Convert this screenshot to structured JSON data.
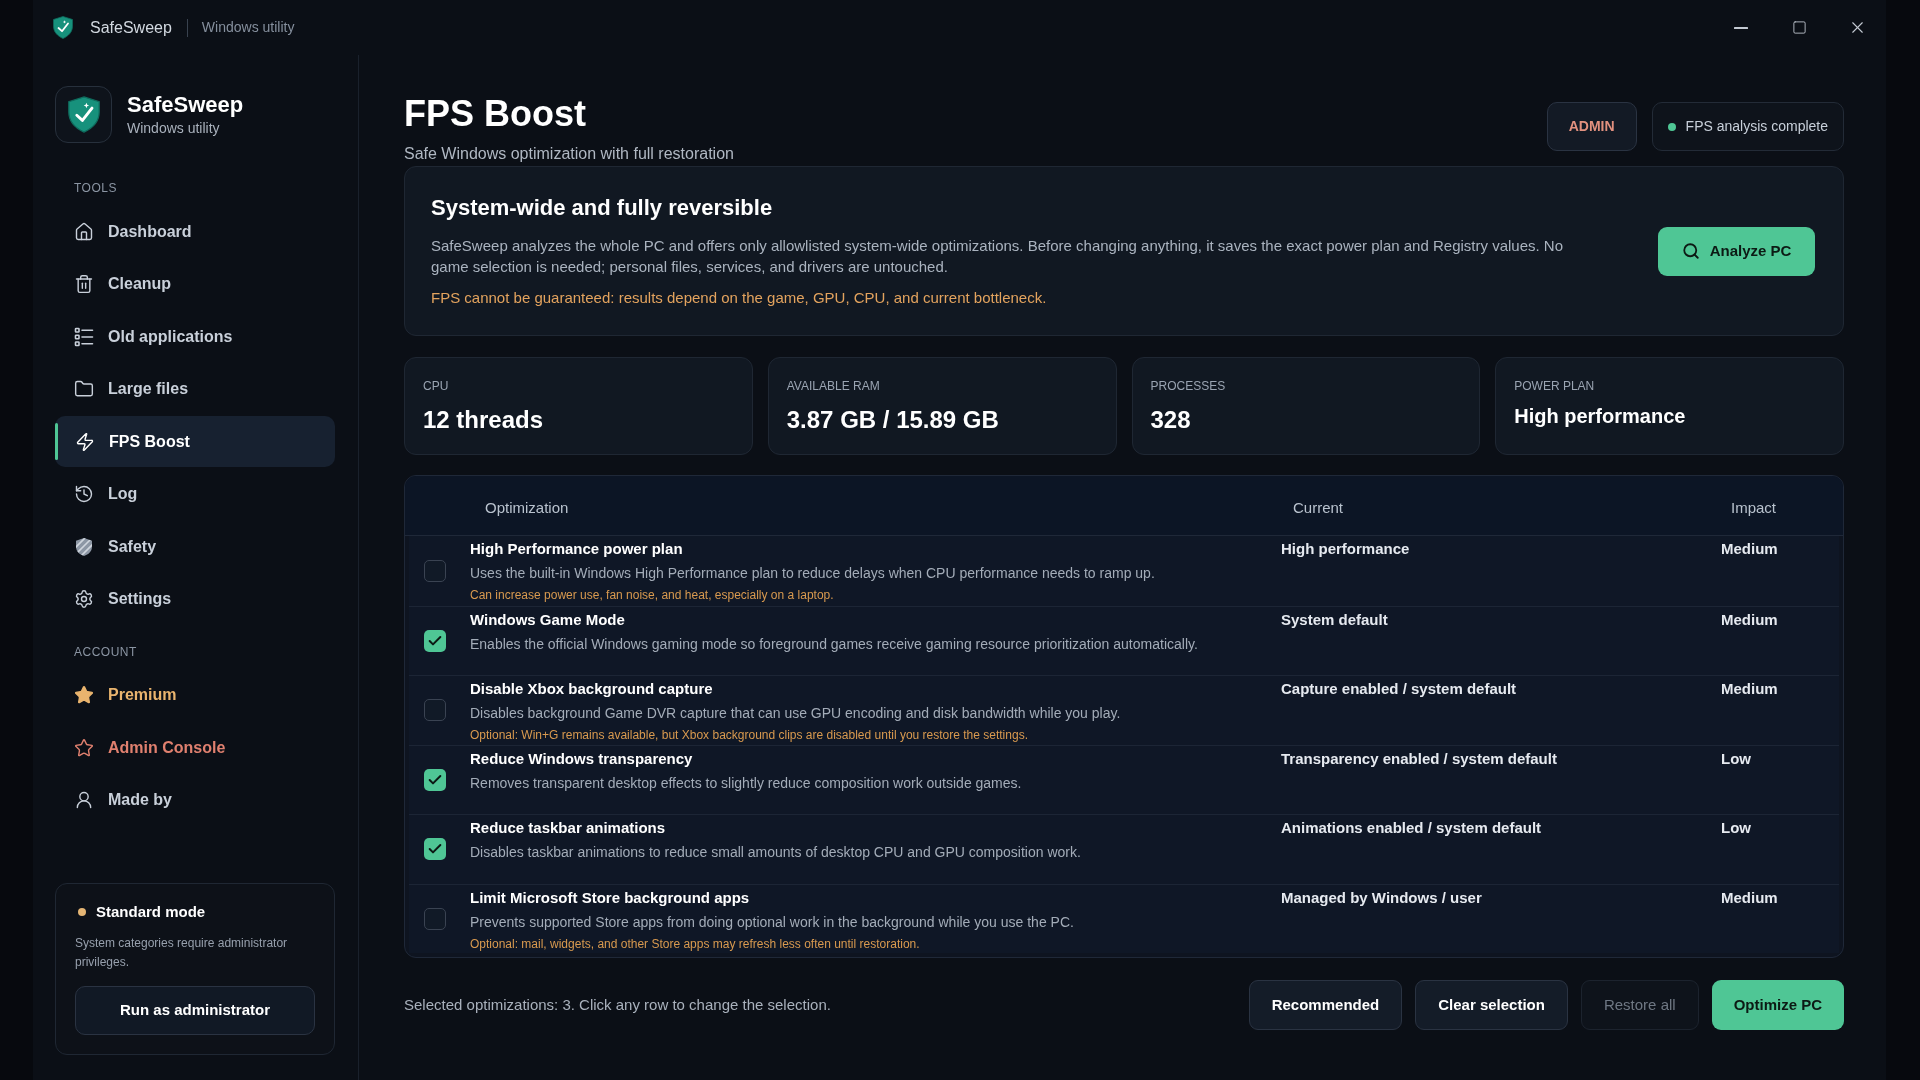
{
  "window": {
    "title": "SafeSweep",
    "subtitle": "Windows utility"
  },
  "sidebar": {
    "brand": {
      "name": "SafeSweep",
      "tagline": "Windows utility"
    },
    "sections": [
      {
        "label": "TOOLS",
        "items": [
          {
            "label": "Dashboard",
            "selected": false
          },
          {
            "label": "Cleanup",
            "selected": false
          },
          {
            "label": "Old applications",
            "selected": false
          },
          {
            "label": "Large files",
            "selected": false
          },
          {
            "label": "FPS Boost",
            "selected": true
          },
          {
            "label": "Log",
            "selected": false
          },
          {
            "label": "Safety",
            "selected": false
          },
          {
            "label": "Settings",
            "selected": false
          }
        ]
      },
      {
        "label": "ACCOUNT",
        "items": [
          {
            "label": "Premium",
            "selected": false,
            "color": "#e9b46e"
          },
          {
            "label": "Admin Console",
            "selected": false,
            "color": "#e0806f"
          },
          {
            "label": "Made by",
            "selected": false
          }
        ]
      }
    ],
    "mode_card": {
      "title": "Standard mode",
      "description": "System categories require administrator privileges.",
      "button": "Run as administrator"
    }
  },
  "header": {
    "title": "FPS Boost",
    "subtitle": "Safe Windows optimization with full restoration",
    "badges": [
      {
        "label": "ADMIN",
        "kind": "role"
      },
      {
        "label": "FPS analysis complete",
        "kind": "status"
      }
    ]
  },
  "info_card": {
    "title": "System-wide and fully reversible",
    "description": "SafeSweep analyzes the whole PC and offers only allowlisted system-wide optimizations. Before changing anything, it saves the exact power plan and Registry values. No game selection is needed; personal files, services, and drivers are untouched.",
    "warning": "FPS cannot be guaranteed: results depend on the game, GPU, CPU, and current bottleneck.",
    "button": "Analyze PC"
  },
  "stats": [
    {
      "label": "CPU",
      "value": "12 threads",
      "kind": "metric"
    },
    {
      "label": "AVAILABLE RAM",
      "value": "3.87 GB / 15.89 GB",
      "kind": "metric"
    },
    {
      "label": "PROCESSES",
      "value": "328",
      "kind": "metric"
    },
    {
      "label": "POWER PLAN",
      "value": "High performance",
      "kind": "text"
    }
  ],
  "table": {
    "columns": [
      "Optimization",
      "Current",
      "Impact"
    ],
    "rows": [
      {
        "checked": false,
        "title": "High Performance power plan",
        "description": "Uses the built-in Windows High Performance plan to reduce delays when CPU performance needs to ramp up.",
        "note": "Can increase power use, fan noise, and heat, especially on a laptop.",
        "current": "High performance",
        "impact": "Medium"
      },
      {
        "checked": true,
        "title": "Windows Game Mode",
        "description": "Enables the official Windows gaming mode so foreground games receive gaming resource prioritization automatically.",
        "current": "System default",
        "impact": "Medium"
      },
      {
        "checked": false,
        "title": "Disable Xbox background capture",
        "description": "Disables background Game DVR capture that can use GPU encoding and disk bandwidth while you play.",
        "note": "Optional: Win+G remains available, but Xbox background clips are disabled until you restore the settings.",
        "current": "Capture enabled / system default",
        "impact": "Medium"
      },
      {
        "checked": true,
        "title": "Reduce Windows transparency",
        "description": "Removes transparent desktop effects to slightly reduce composition work outside games.",
        "current": "Transparency enabled / system default",
        "impact": "Low"
      },
      {
        "checked": true,
        "title": "Reduce taskbar animations",
        "description": "Disables taskbar animations to reduce small amounts of desktop CPU and GPU composition work.",
        "current": "Animations enabled / system default",
        "impact": "Low"
      },
      {
        "checked": false,
        "title": "Limit Microsoft Store background apps",
        "description": "Prevents supported Store apps from doing optional work in the background while you use the PC.",
        "note": "Optional: mail, widgets, and other Store apps may refresh less often until restoration.",
        "current": "Managed by Windows / user",
        "impact": "Medium"
      }
    ]
  },
  "footer": {
    "summary": "Selected optimizations: 3. Click any row to change the selection.",
    "buttons": [
      {
        "label": "Recommended",
        "kind": "secondary",
        "disabled": false
      },
      {
        "label": "Clear selection",
        "kind": "secondary",
        "disabled": false
      },
      {
        "label": "Restore all",
        "kind": "secondary",
        "disabled": true
      },
      {
        "label": "Optimize PC",
        "kind": "primary",
        "disabled": false
      }
    ]
  }
}
